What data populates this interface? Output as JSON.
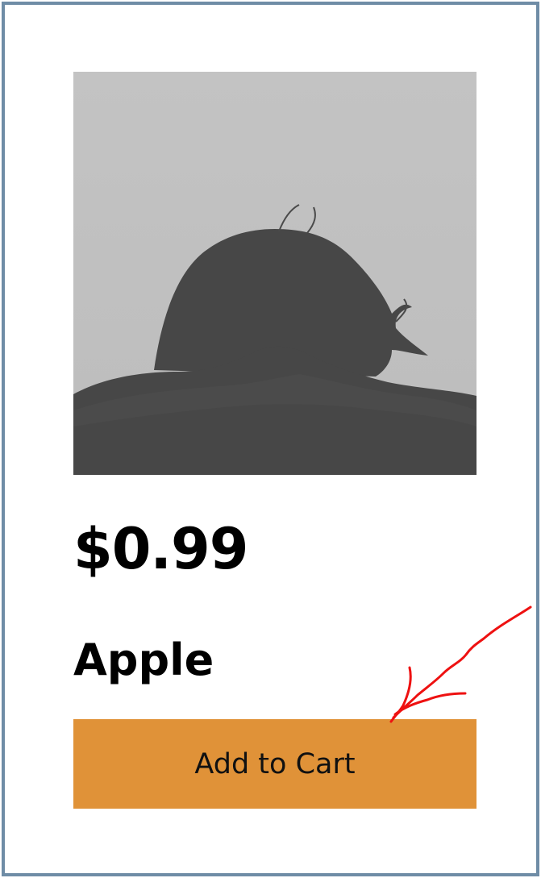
{
  "product": {
    "image_icon": "person-silhouette-photo",
    "price": "$0.99",
    "name": "Apple",
    "add_to_cart_label": "Add to Cart"
  },
  "colors": {
    "card_border": "#6f8ca6",
    "image_background": "#c2c2c2",
    "image_figure": "#454545",
    "button_background": "#e09238",
    "button_text": "#111111",
    "annotation_stroke": "#ee1111"
  },
  "annotation": {
    "type": "hand-drawn-arrow",
    "icon": "red-arrow-annotation-icon"
  }
}
